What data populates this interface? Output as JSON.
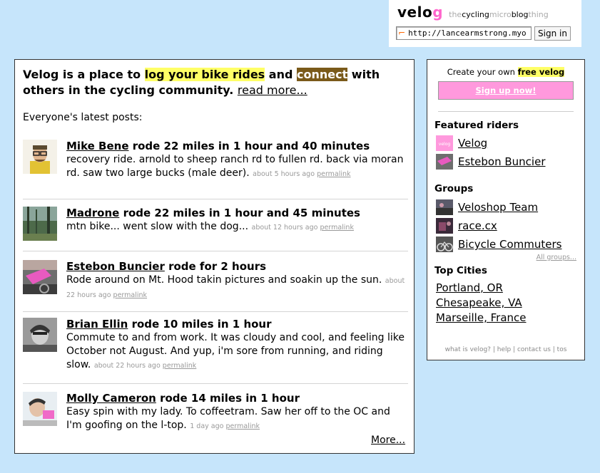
{
  "header": {
    "logo_velo": "velo",
    "logo_g": "g",
    "tagline": [
      {
        "text": "the",
        "dark": false
      },
      {
        "text": "cycling",
        "dark": true
      },
      {
        "text": "micro",
        "dark": false
      },
      {
        "text": "blog",
        "dark": true
      },
      {
        "text": "thing",
        "dark": false
      }
    ],
    "openid_icon": "openid-icon",
    "openid_value": "http://lancearmstrong.myo",
    "signin_label": "Sign in"
  },
  "intro": {
    "part1": "Velog is a place to ",
    "highlight1": "log your bike rides",
    "part2": " and ",
    "highlight2": "connect",
    "part3": " with others in the cycling community. ",
    "read_more": "read more..."
  },
  "latest_label": "Everyone's latest posts:",
  "posts": [
    {
      "rider": "Mike Bene",
      "action": " rode 22 miles in 1 hour and 40 minutes",
      "body": "recovery ride. arnold to sheep ranch rd to fullen rd. back via moran rd. saw two large bucks (male deer). ",
      "time": "about 5 hours ago",
      "permalink": "permalink"
    },
    {
      "rider": "Madrone",
      "action": " rode 22 miles in 1 hour and 45 minutes",
      "body": "mtn bike... went slow with the dog... ",
      "time": "about 12 hours ago",
      "permalink": "permalink"
    },
    {
      "rider": "Estebon Buncier",
      "action": " rode for 2 hours",
      "body": "Rode around on Mt. Hood takin pictures and soakin up the sun. ",
      "time": "about 22 hours ago",
      "permalink": "permalink"
    },
    {
      "rider": "Brian Ellin",
      "action": " rode 10 miles in 1 hour",
      "body": "Commute to and from work. It was cloudy and cool, and feeling like October not August. And yup, i'm sore from running, and riding slow. ",
      "time": "about 22 hours ago",
      "permalink": "permalink"
    },
    {
      "rider": "Molly Cameron",
      "action": " rode 14 miles in 1 hour",
      "body": "Easy spin with my lady. To coffeetram. Saw her off to the OC and I'm goofing on the l-top. ",
      "time": "1 day ago",
      "permalink": "permalink"
    }
  ],
  "more_link": "More...",
  "sidebar": {
    "create_text": "Create your own ",
    "create_highlight": "free velog",
    "signup_label": "Sign up now!",
    "featured_heading": "Featured riders",
    "featured": [
      {
        "name": "Velog",
        "thumb_text": "velog"
      },
      {
        "name": "Estebon Buncier",
        "thumb_text": ""
      }
    ],
    "groups_heading": "Groups",
    "groups": [
      {
        "name": "Veloshop Team"
      },
      {
        "name": "race.cx"
      },
      {
        "name": "Bicycle Commuters"
      }
    ],
    "all_groups": "All groups...",
    "cities_heading": "Top Cities",
    "cities": [
      "Portland, OR",
      "Chesapeake, VA",
      "Marseille, France"
    ],
    "footer": [
      {
        "label": "what is velog?"
      },
      {
        "label": "help"
      },
      {
        "label": "contact us"
      },
      {
        "label": "tos"
      }
    ],
    "footer_sep": " | "
  },
  "colors": {
    "background": "#c6e5fb",
    "highlight_yellow": "#ffff66",
    "connect_brown": "#7a5a1a",
    "signup_pink": "#ff99dd",
    "logo_pink": "#ff66cc"
  }
}
